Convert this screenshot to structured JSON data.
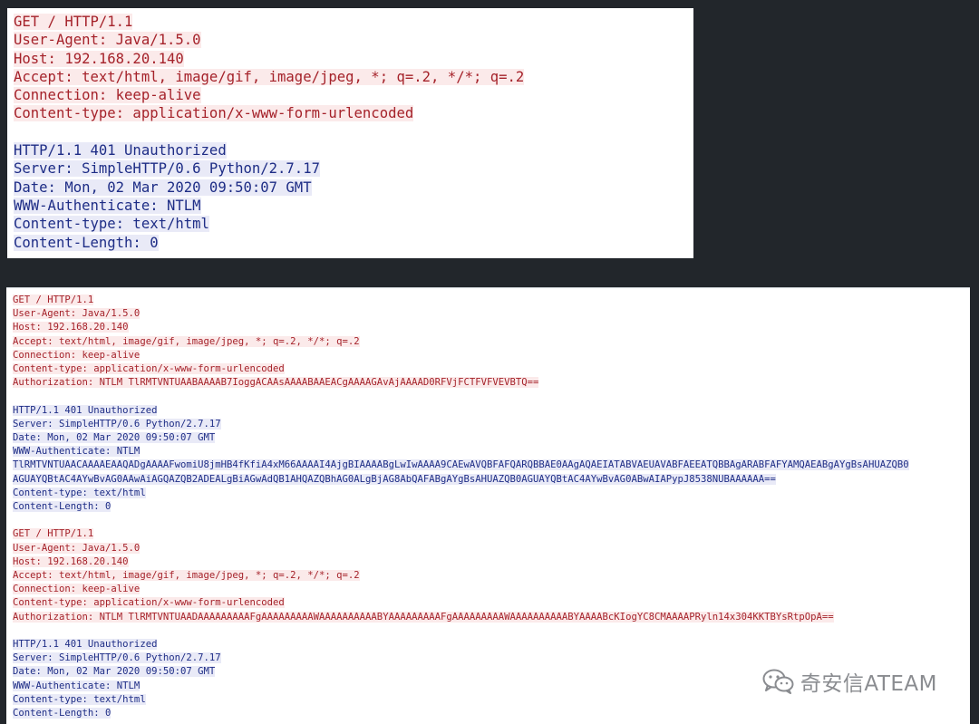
{
  "panel1": {
    "request": [
      "GET / HTTP/1.1",
      "User-Agent: Java/1.5.0",
      "Host: 192.168.20.140",
      "Accept: text/html, image/gif, image/jpeg, *; q=.2, */*; q=.2",
      "Connection: keep-alive",
      "Content-type: application/x-www-form-urlencoded"
    ],
    "response": [
      "HTTP/1.1 401 Unauthorized",
      "Server: SimpleHTTP/0.6 Python/2.7.17",
      "Date: Mon, 02 Mar 2020 09:50:07 GMT",
      "WWW-Authenticate: NTLM",
      "Content-type: text/html",
      "Content-Length: 0"
    ]
  },
  "panel2": {
    "request1": [
      "GET / HTTP/1.1",
      "User-Agent: Java/1.5.0",
      "Host: 192.168.20.140",
      "Accept: text/html, image/gif, image/jpeg, *; q=.2, */*; q=.2",
      "Connection: keep-alive",
      "Content-type: application/x-www-form-urlencoded",
      "Authorization: NTLM TlRMTVNTUAABAAAAB7IoggACAAsAAAABAAEACgAAAAGAvAjAAAAD0RFVjFCTFVFVEVBTQ=="
    ],
    "response1": [
      "HTTP/1.1 401 Unauthorized",
      "Server: SimpleHTTP/0.6 Python/2.7.17",
      "Date: Mon, 02 Mar 2020 09:50:07 GMT",
      "WWW-Authenticate: NTLM",
      "TlRMTVNTUAACAAAAEAAQADgAAAAFwomiU8jmHB4fKfiA4xM66AAAAI4AjgBIAAAABgLwIwAAAA9CAEwAVQBFAFQARQBBAE0AAgAQAEIATABVAEUAVABFAEEATQBBAgARABFAFYAMQAEABgAYgBsAHUAZQB0",
      "AGUAYQBtAC4AYwBvAG0AAwAiAGQAZQB2ADEALgBiAGwAdQB1AHQAZQBhAG0ALgBjAG8AbQAFABgAYgBsAHUAZQB0AGUAYQBtAC4AYwBvAG0ABwAIAPypJ8538NUBAAAAAA==",
      "Content-type: text/html",
      "Content-Length: 0"
    ],
    "request2": [
      "GET / HTTP/1.1",
      "User-Agent: Java/1.5.0",
      "Host: 192.168.20.140",
      "Accept: text/html, image/gif, image/jpeg, *; q=.2, */*; q=.2",
      "Connection: keep-alive",
      "Content-type: application/x-www-form-urlencoded",
      "Authorization: NTLM TlRMTVNTUAADAAAAAAAAAFgAAAAAAAAAWAAAAAAAAAABYAAAAAAAAAFgAAAAAAAAAWAAAAAAAAAABYAAAABcKIogYC8CMAAAAPRyln14x304KKTBYsRtpOpA=="
    ],
    "response2": [
      "HTTP/1.1 401 Unauthorized",
      "Server: SimpleHTTP/0.6 Python/2.7.17",
      "Date: Mon, 02 Mar 2020 09:50:07 GMT",
      "WWW-Authenticate: NTLM",
      "Content-type: text/html",
      "Content-Length: 0"
    ]
  },
  "watermark": {
    "text": "奇安信ATEAM",
    "icon": "wechat-icon"
  },
  "colors": {
    "request_text": "#a5222a",
    "request_bg": "#fbeaea",
    "response_text": "#1e2d86",
    "response_bg": "#e9eaf7",
    "background": "#22262b"
  }
}
